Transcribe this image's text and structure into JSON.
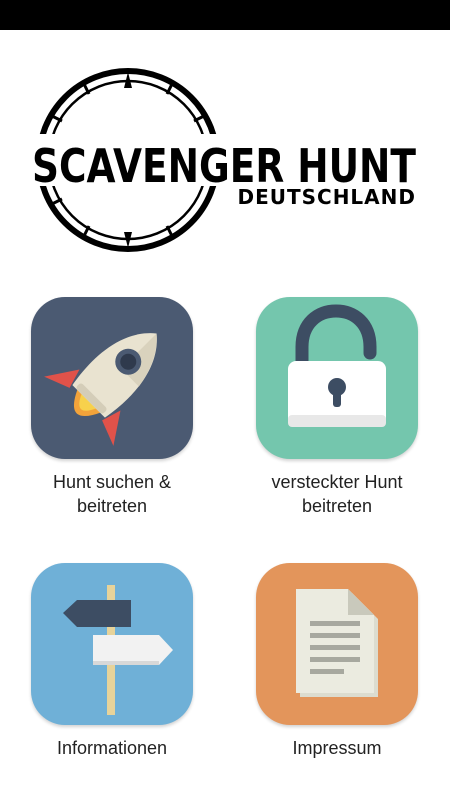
{
  "logo": {
    "title": "SCAVENGER HUNT",
    "subtitle": "DEUTSCHLAND"
  },
  "menu": [
    {
      "label_line1": "Hunt suchen &",
      "label_line2": "beitreten",
      "icon": "rocket-icon",
      "color": "#4b5a72"
    },
    {
      "label_line1": "versteckter Hunt",
      "label_line2": "beitreten",
      "icon": "open-padlock-icon",
      "color": "#74c6ad"
    },
    {
      "label_line1": "Informationen",
      "label_line2": "",
      "icon": "signpost-icon",
      "color": "#6fb0d7"
    },
    {
      "label_line1": "Impressum",
      "label_line2": "",
      "icon": "document-icon",
      "color": "#e3955b"
    }
  ]
}
